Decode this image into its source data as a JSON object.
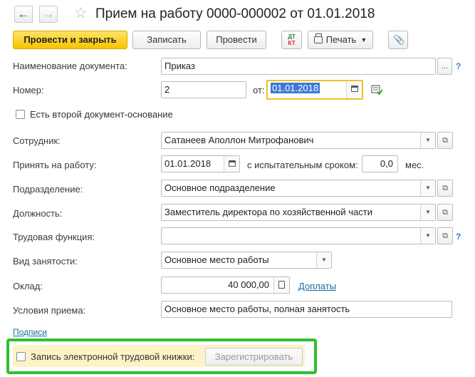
{
  "window": {
    "title": "Прием на работу 0000-000002 от 01.01.2018",
    "back_glyph": "←",
    "forward_glyph": "→",
    "favorite_glyph": "☆"
  },
  "toolbar": {
    "post_and_close": "Провести и закрыть",
    "save": "Записать",
    "post": "Провести",
    "dt_kt_top": "ДТ",
    "dt_kt_bottom": "КТ",
    "print": "Печать",
    "attach_glyph": "📎"
  },
  "form": {
    "doc_name": {
      "label": "Наименование документа:",
      "value": "Приказ",
      "button": "..."
    },
    "number": {
      "label": "Номер:",
      "value": "2",
      "date_label": "от:",
      "date_value": "01.01.2018"
    },
    "second_doc_checkbox": {
      "label": "Есть второй документ-основание",
      "checked": false
    },
    "employee": {
      "label": "Сотрудник:",
      "value": "Сатанеев Аполлон Митрофанович"
    },
    "hire_date": {
      "label": "Принять на работу:",
      "value": "01.01.2018",
      "probation_label": "с испытательным сроком:",
      "probation_value": "0,0",
      "probation_unit": "мес."
    },
    "department": {
      "label": "Подразделение:",
      "value": "Основное подразделение"
    },
    "position": {
      "label": "Должность:",
      "value": "Заместитель директора по хозяйственной части"
    },
    "labor_function": {
      "label": "Трудовая функция:",
      "value": ""
    },
    "employment_type": {
      "label": "Вид занятости:",
      "value": "Основное место работы"
    },
    "salary": {
      "label": "Оклад:",
      "value": "40 000,00",
      "link": "Доплаты"
    },
    "conditions": {
      "label": "Условия приема:",
      "value": "Основное место работы, полная занятость"
    },
    "signatures_link": "Подписи",
    "electronic_book": {
      "label": "Запись электронной трудовой книжки:",
      "checked": false,
      "button": "Зарегистрировать"
    },
    "help_glyph": "?",
    "dropdown_glyph": "▼",
    "open_glyph": "⧉"
  },
  "colors": {
    "primary_button": "#f5c400",
    "highlight_frame": "#2fbf2f",
    "focus_border": "#f0c020",
    "selection": "#3d78d8",
    "link": "#1d6a9e"
  }
}
